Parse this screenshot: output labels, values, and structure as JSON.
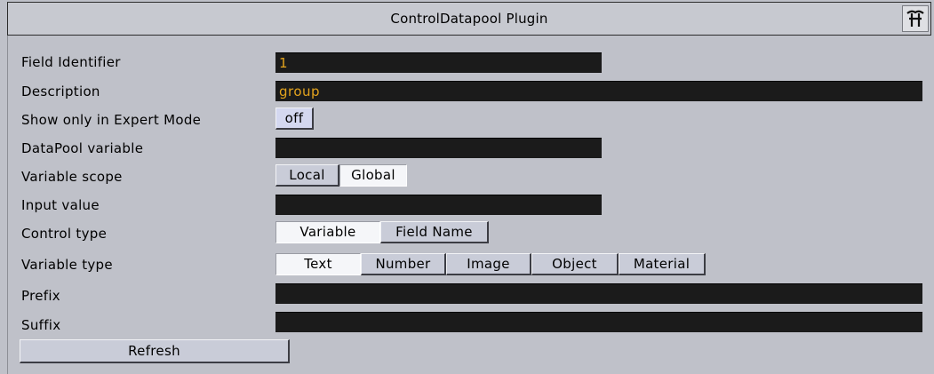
{
  "window": {
    "title": "ControlDatapool Plugin",
    "corner_icon": "plugin-logo-icon"
  },
  "rows": {
    "field_identifier": {
      "label": "Field Identifier",
      "value": "1"
    },
    "description": {
      "label": "Description",
      "value": "group"
    },
    "expert_mode": {
      "label": "Show only in Expert Mode",
      "value": "off"
    },
    "datapool_variable": {
      "label": "DataPool variable",
      "value": ""
    },
    "variable_scope": {
      "label": "Variable scope",
      "options": [
        "Local",
        "Global"
      ],
      "selected": "Global"
    },
    "input_value": {
      "label": "Input value",
      "value": ""
    },
    "control_type": {
      "label": "Control type",
      "options": [
        "Variable",
        "Field Name"
      ],
      "selected": "Variable"
    },
    "variable_type": {
      "label": "Variable type",
      "options": [
        "Text",
        "Number",
        "Image",
        "Object",
        "Material"
      ],
      "selected": "Text"
    },
    "prefix": {
      "label": "Prefix",
      "value": ""
    },
    "suffix": {
      "label": "Suffix",
      "value": ""
    }
  },
  "actions": {
    "refresh_label": "Refresh"
  },
  "colors": {
    "background": "#bfc1c9",
    "field_background": "#1b1b1b",
    "field_text": "#e3a31d",
    "button_face": "#c9ccd8",
    "button_selected": "#f5f6f9"
  }
}
